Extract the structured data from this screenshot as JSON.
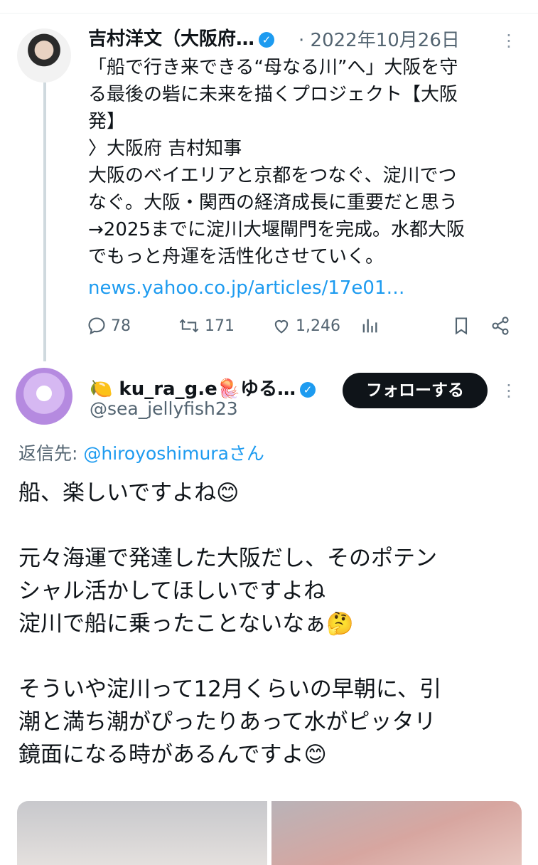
{
  "tweet1": {
    "author_name": "吉村洋文（大阪府…",
    "separator": "·",
    "date": "2022年10月26日",
    "lines": [
      "「船で行き来できる“母なる川”へ」大阪を守",
      "る最後の砦に未来を描くプロジェクト【大阪",
      "発】",
      "〉大阪府 吉村知事",
      "大阪のベイエリアと京都をつなぐ、淀川でつ",
      "なぐ。大阪・関西の経済成長に重要だと思う",
      "→2025までに淀川大堰閘門を完成。水都大阪",
      "でもっと舟運を活性化させていく。"
    ],
    "link": "news.yahoo.co.jp/articles/17e01…",
    "replies": "78",
    "retweets": "171",
    "likes": "1,246"
  },
  "tweet2": {
    "author_name": "🍋 ku_ra_g.e🪼ゆる…",
    "handle": "@sea_jellyfish23",
    "follow_label": "フォローする",
    "reply_prefix": "返信先: ",
    "reply_mention": "@hiroyoshimuraさん",
    "lines": [
      "船、楽しいですよね😊",
      "",
      "元々海運で発達した大阪だし、そのポテン",
      "シャル活かしてほしいですよね",
      "淀川で船に乗ったことないなぁ🤔",
      "",
      "そういや淀川って12月くらいの早朝に、引",
      "潮と満ち潮がぴったりあって水がピッタリ",
      "鏡面になる時があるんですよ😊"
    ]
  },
  "icons": {
    "verified": "verified-badge-icon",
    "more": "more-icon",
    "reply": "reply-icon",
    "retweet": "retweet-icon",
    "like": "like-icon",
    "views": "views-icon",
    "bookmark": "bookmark-icon",
    "share": "share-icon"
  },
  "colors": {
    "accent": "#1d9bf0",
    "text": "#0f1419",
    "secondary": "#536471"
  }
}
